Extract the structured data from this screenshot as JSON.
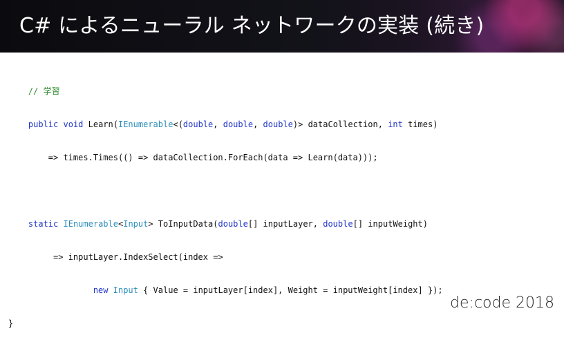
{
  "slide": {
    "title": "C# によるニューラル ネットワークの実装 (続き)",
    "footer": "de:code 2018"
  },
  "code": {
    "line1": {
      "indent": "    ",
      "comment": "// 学習"
    },
    "line2": {
      "indent": "    ",
      "kw_public": "public",
      "sp1": " ",
      "kw_void": "void",
      "t1": " Learn(",
      "ty_ienum": "IEnumerable",
      "t2": "<(",
      "kw_double1": "double",
      "t3": ", ",
      "kw_double2": "double",
      "t4": ", ",
      "kw_double3": "double",
      "t5": ")> dataCollection, ",
      "kw_int": "int",
      "t6": " times)"
    },
    "line3": {
      "indent": "        ",
      "text": "=> times.Times(() => dataCollection.ForEach(data => Learn(data)));"
    },
    "line4": {
      "text": ""
    },
    "line5": {
      "indent": "    ",
      "kw_static": "static",
      "sp1": " ",
      "ty_ienum": "IEnumerable",
      "t1": "<",
      "ty_input": "Input",
      "t2": "> ToInputData(",
      "kw_double1": "double",
      "t3": "[] inputLayer, ",
      "kw_double2": "double",
      "t4": "[] inputWeight)"
    },
    "line6": {
      "indent": "         ",
      "text": "=> inputLayer.IndexSelect(index =>"
    },
    "line7": {
      "indent": "                 ",
      "kw_new": "new",
      "sp1": " ",
      "ty_input": "Input",
      "t1": " { Value = inputLayer[index], Weight = inputWeight[index] });"
    },
    "line8": {
      "text": "}"
    }
  },
  "colors": {
    "keyword": "#1f35c8",
    "type": "#2a8bb8",
    "comment": "#2e8b2e",
    "title_bg": "#121219",
    "accent": "#d63a8c"
  }
}
